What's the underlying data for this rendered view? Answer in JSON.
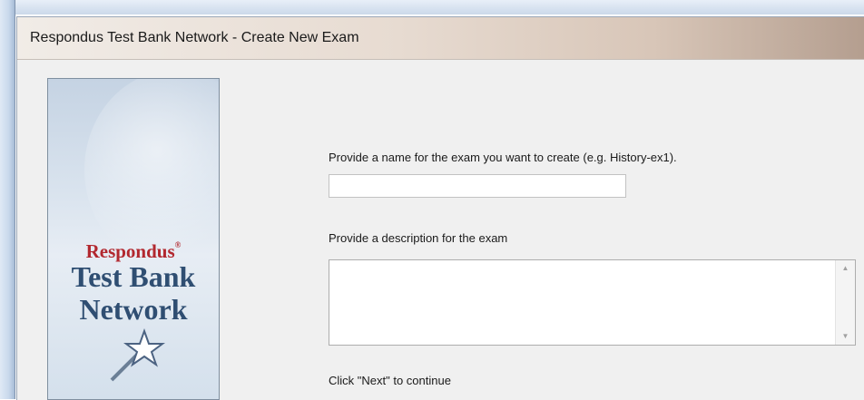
{
  "window": {
    "title": "Respondus Test Bank Network - Create New Exam"
  },
  "banner": {
    "brand": "Respondus",
    "brand_mark": "®",
    "product_line1": "Test Bank",
    "product_line2": "Network",
    "icon": "magic-wand-star-icon"
  },
  "form": {
    "name_prompt": "Provide a name for the exam you want to create (e.g. History-ex1).",
    "name_value": "",
    "description_prompt": "Provide a description for the exam",
    "description_value": "",
    "continue_hint": "Click \"Next\" to continue"
  },
  "scrollbar": {
    "up_icon": "scroll-up-arrow-icon",
    "down_icon": "scroll-down-arrow-icon"
  },
  "colors": {
    "brand_red": "#b2282f",
    "brand_blue": "#2f4e72",
    "dialog_bg": "#f0f0f0"
  }
}
